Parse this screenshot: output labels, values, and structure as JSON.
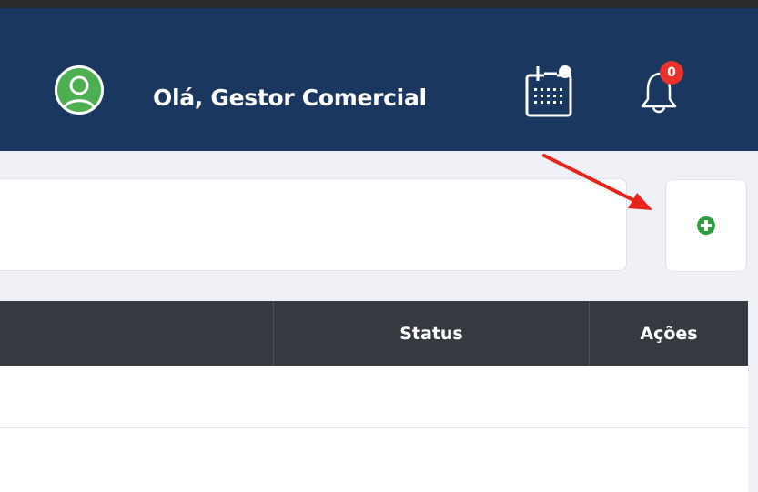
{
  "header": {
    "greeting": "Olá, Gestor Comercial",
    "avatar_icon": "user-circle-icon",
    "calendar_icon": "calendar-icon",
    "notifications": {
      "icon": "bell-icon",
      "count": "0"
    },
    "colors": {
      "header_bg": "#1a375f",
      "avatar_green": "#4caf50",
      "badge_red": "#e8322c"
    }
  },
  "toolbar": {
    "search_placeholder": "",
    "add_button_icon": "plus-circle-icon",
    "add_color": "#2e9e3e"
  },
  "annotation": {
    "arrow_color": "#e8231c"
  },
  "table": {
    "columns": [
      "",
      "Status",
      "Ações"
    ],
    "rows": [
      [
        "",
        "",
        ""
      ]
    ],
    "header_bg": "#343a40"
  }
}
